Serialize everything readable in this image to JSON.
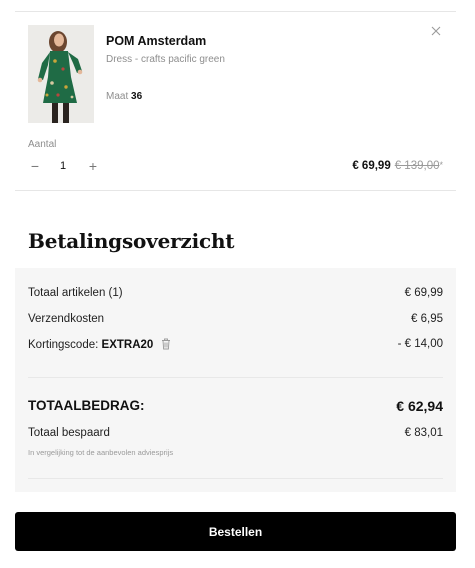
{
  "cart_item": {
    "brand": "POM Amsterdam",
    "description": "Dress - crafts pacific green",
    "size_label": "Maat",
    "size_value": "36",
    "quantity_label": "Aantal",
    "quantity": "1",
    "minus_symbol": "−",
    "plus_symbol": "+",
    "price_current": "€ 69,99",
    "price_original": "€ 139,00",
    "price_asterisk": "*",
    "remove_icon": "close-icon"
  },
  "summary": {
    "title": "Betalingsoverzicht",
    "items_label": "Totaal artikelen (1)",
    "items_value": "€ 69,99",
    "shipping_label": "Verzendkosten",
    "shipping_value": "€ 6,95",
    "code_label": "Kortingscode:",
    "code_value": "EXTRA20",
    "code_discount": "- € 14,00",
    "code_remove_icon": "trash-icon",
    "total_label": "TOTAALBEDRAG:",
    "total_value": "€ 62,94",
    "saved_label": "Totaal bespaard",
    "saved_value": "€ 83,01",
    "saved_note": "In vergelijking tot de aanbevolen adviesprijs"
  },
  "actions": {
    "order_label": "Bestellen"
  },
  "colors": {
    "button_bg": "#000000",
    "summary_bg": "#f6f6f6",
    "dress_green": "#1f6b45"
  }
}
